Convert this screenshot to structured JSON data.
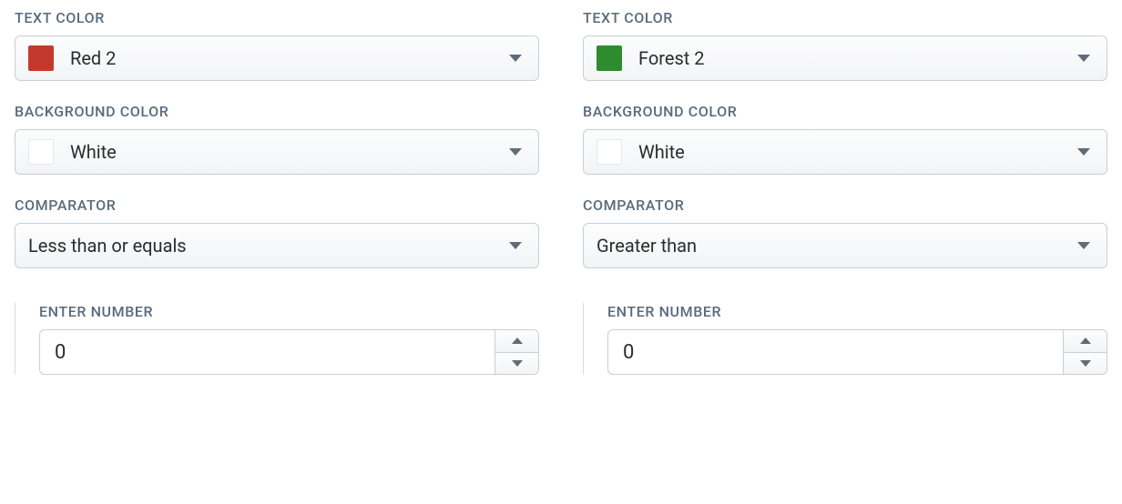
{
  "left": {
    "textColor": {
      "label": "TEXT COLOR",
      "value": "Red 2",
      "swatch": "#c33a2c"
    },
    "bgColor": {
      "label": "BACKGROUND COLOR",
      "value": "White",
      "swatch": "#ffffff"
    },
    "comparator": {
      "label": "COMPARATOR",
      "value": "Less than or equals"
    },
    "number": {
      "label": "ENTER NUMBER",
      "value": "0"
    }
  },
  "right": {
    "textColor": {
      "label": "TEXT COLOR",
      "value": "Forest 2",
      "swatch": "#2e8b2e"
    },
    "bgColor": {
      "label": "BACKGROUND COLOR",
      "value": "White",
      "swatch": "#ffffff"
    },
    "comparator": {
      "label": "COMPARATOR",
      "value": "Greater than"
    },
    "number": {
      "label": "ENTER NUMBER",
      "value": "0"
    }
  }
}
